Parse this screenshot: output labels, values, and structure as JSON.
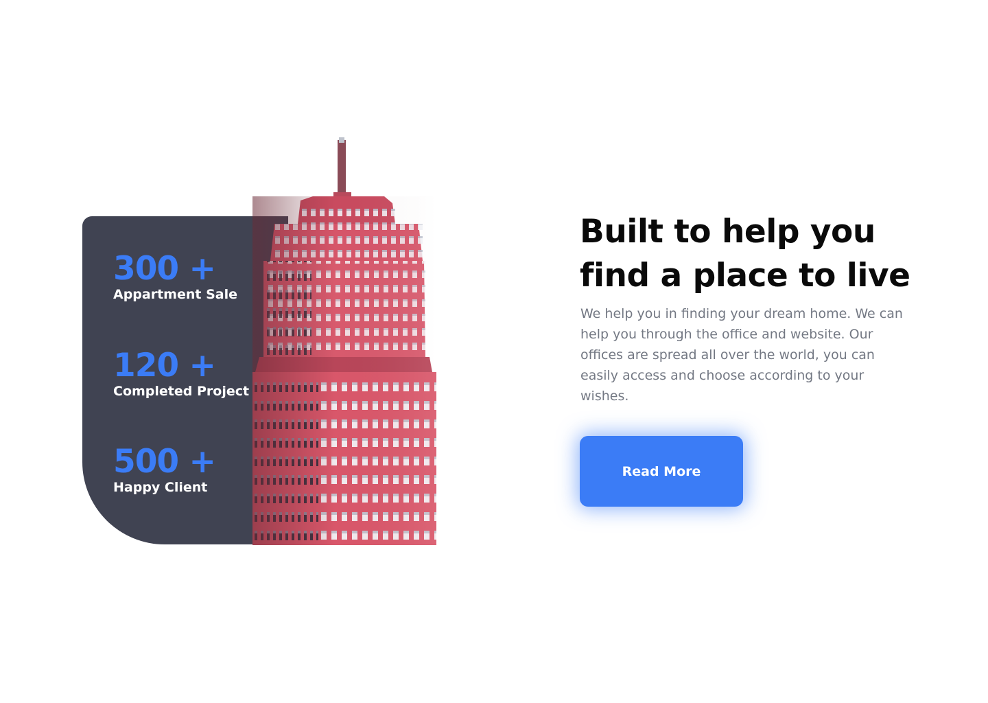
{
  "stats": [
    {
      "value": "300 +",
      "label": "Appartment Sale"
    },
    {
      "value": "120 +",
      "label": "Completed Project"
    },
    {
      "value": "500 +",
      "label": "Happy Client"
    }
  ],
  "hero": {
    "headline_line1": "Built to help you",
    "headline_line2": "find a place to live",
    "description": "We help you in finding your dream home. We can help you through the office and website. Our offices are spread all over the world, you can easily access and choose according to your wishes.",
    "button_label": "Read More"
  },
  "colors": {
    "accent": "#3b7cf6",
    "card_bg": "#404352",
    "building": "#d9576a",
    "text_dark": "#0a0a0a",
    "text_muted": "#737883"
  }
}
